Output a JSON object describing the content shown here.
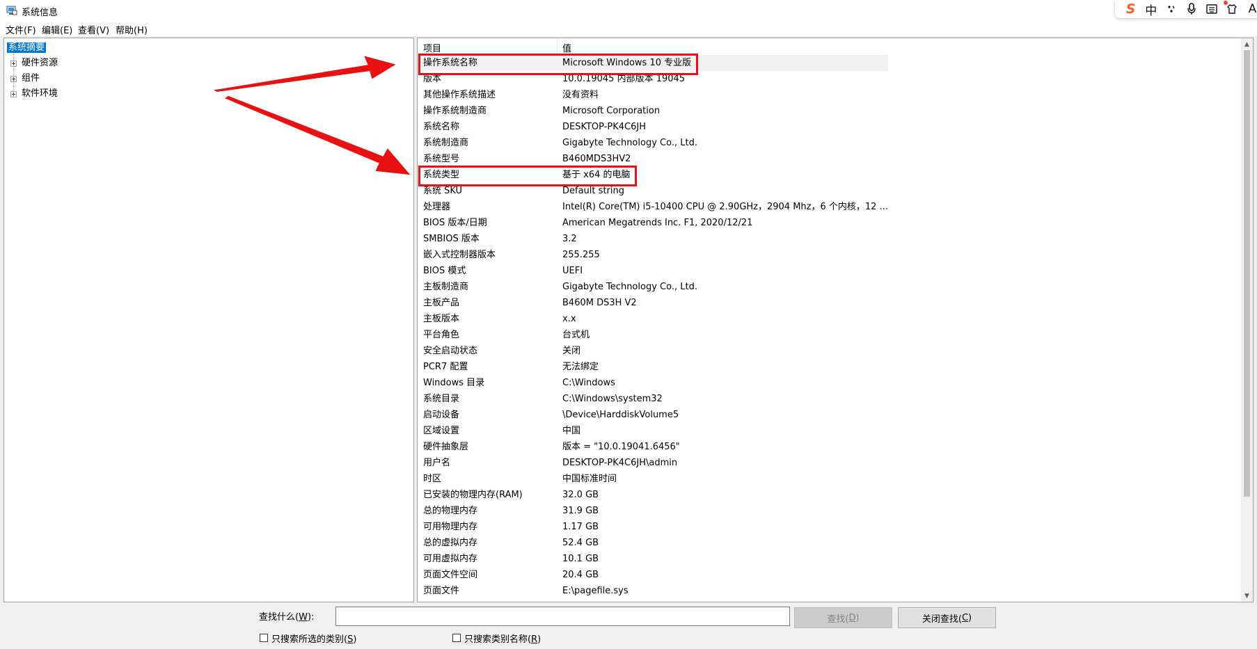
{
  "window": {
    "title": "系统信息"
  },
  "ime": {
    "logo": "S",
    "mode": "中",
    "icons": [
      "punctuation-icon",
      "microphone-icon",
      "keyboard-icon",
      "skin-icon"
    ],
    "overflow": "A"
  },
  "menu": [
    {
      "label": "文件(F)"
    },
    {
      "label": "编辑(E)"
    },
    {
      "label": "查看(V)"
    },
    {
      "label": "帮助(H)"
    }
  ],
  "tree": {
    "selected": "系统摘要",
    "children": [
      {
        "label": "硬件资源"
      },
      {
        "label": "组件"
      },
      {
        "label": "软件环境"
      }
    ]
  },
  "table": {
    "headers": [
      "项目",
      "值"
    ],
    "rows": [
      {
        "k": "操作系统名称",
        "v": "Microsoft Windows 10 专业版"
      },
      {
        "k": "版本",
        "v": "10.0.19045 内部版本 19045"
      },
      {
        "k": "其他操作系统描述",
        "v": "没有资料"
      },
      {
        "k": "操作系统制造商",
        "v": "Microsoft Corporation"
      },
      {
        "k": "系统名称",
        "v": "DESKTOP-PK4C6JH"
      },
      {
        "k": "系统制造商",
        "v": "Gigabyte Technology Co., Ltd."
      },
      {
        "k": "系统型号",
        "v": "B460MDS3HV2"
      },
      {
        "k": "系统类型",
        "v": "基于 x64 的电脑"
      },
      {
        "k": "系统 SKU",
        "v": "Default string"
      },
      {
        "k": "处理器",
        "v": "Intel(R) Core(TM) i5-10400 CPU @ 2.90GHz，2904 Mhz，6 个内核，12 ..."
      },
      {
        "k": "BIOS 版本/日期",
        "v": "American Megatrends Inc. F1, 2020/12/21"
      },
      {
        "k": "SMBIOS 版本",
        "v": "3.2"
      },
      {
        "k": "嵌入式控制器版本",
        "v": "255.255"
      },
      {
        "k": "BIOS 模式",
        "v": "UEFI"
      },
      {
        "k": "主板制造商",
        "v": "Gigabyte Technology Co., Ltd."
      },
      {
        "k": "主板产品",
        "v": "B460M DS3H V2"
      },
      {
        "k": "主板版本",
        "v": "x.x"
      },
      {
        "k": "平台角色",
        "v": "台式机"
      },
      {
        "k": "安全启动状态",
        "v": "关闭"
      },
      {
        "k": "PCR7 配置",
        "v": "无法绑定"
      },
      {
        "k": "Windows 目录",
        "v": "C:\\Windows"
      },
      {
        "k": "系统目录",
        "v": "C:\\Windows\\system32"
      },
      {
        "k": "启动设备",
        "v": "\\Device\\HarddiskVolume5"
      },
      {
        "k": "区域设置",
        "v": "中国"
      },
      {
        "k": "硬件抽象层",
        "v": "版本 = \"10.0.19041.6456\""
      },
      {
        "k": "用户名",
        "v": "DESKTOP-PK4C6JH\\admin"
      },
      {
        "k": "时区",
        "v": "中国标准时间"
      },
      {
        "k": "已安装的物理内存(RAM)",
        "v": "32.0 GB"
      },
      {
        "k": "总的物理内存",
        "v": "31.9 GB"
      },
      {
        "k": "可用物理内存",
        "v": "1.17 GB"
      },
      {
        "k": "总的虚拟内存",
        "v": "52.4 GB"
      },
      {
        "k": "可用虚拟内存",
        "v": "10.1 GB"
      },
      {
        "k": "页面文件空间",
        "v": "20.4 GB"
      },
      {
        "k": "页面文件",
        "v": "E:\\pagefile.sys"
      }
    ],
    "highlighted_rows": [
      0,
      7
    ]
  },
  "find": {
    "label": "查找什么(",
    "label_key": "W",
    "label_end": "):",
    "input_value": "",
    "find_button": {
      "label": "查找(",
      "key": "D",
      "end": ")"
    },
    "close_button": {
      "label": "关闭查找(",
      "key": "C",
      "end": ")"
    },
    "check1": {
      "label": "只搜索所选的类别(",
      "key": "S",
      "end": ")",
      "checked": false
    },
    "check2": {
      "label": "只搜索类别名称(",
      "key": "R",
      "end": ")",
      "checked": false
    }
  },
  "colors": {
    "selection": "#0078d7",
    "annotation_red": "#e81010"
  }
}
